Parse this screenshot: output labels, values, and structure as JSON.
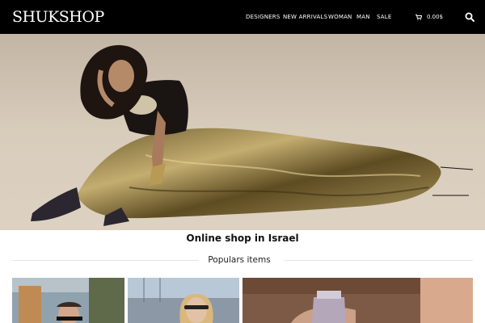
{
  "header": {
    "logo": "SHUKSHOP",
    "nav": [
      "DESIGNERS",
      "NEW ARRIVALS",
      "WOMAN",
      "MAN",
      "SALE"
    ],
    "cart_total": "0.00$"
  },
  "hero": {
    "headline": "Online shop in Israel"
  },
  "section": {
    "title": "Populars items"
  }
}
